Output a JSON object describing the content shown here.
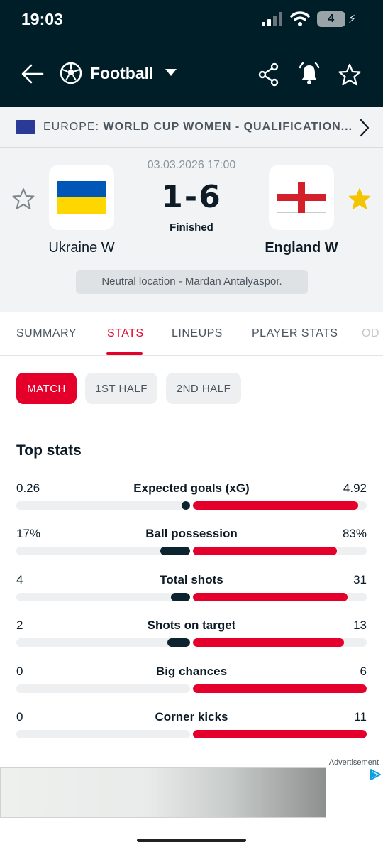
{
  "status_bar": {
    "time": "19:03",
    "battery": "4"
  },
  "nav": {
    "sport": "Football",
    "icons": [
      "back-arrow-icon",
      "football-icon",
      "chevron-down-icon",
      "share-icon",
      "bell-icon",
      "star-icon"
    ]
  },
  "league": {
    "region": "EUROPE:",
    "name": "WORLD CUP WOMEN - QUALIFICATION..."
  },
  "match": {
    "datetime": "03.03.2026 17:00",
    "score": "1-6",
    "status": "Finished",
    "home": {
      "name": "Ukraine W",
      "favorite": false,
      "flag_colors": [
        "#0057b7",
        "#ffd700"
      ]
    },
    "away": {
      "name": "England W",
      "favorite": true
    },
    "venue": "Neutral location - Mardan Antalyaspor."
  },
  "tabs": [
    "SUMMARY",
    "STATS",
    "LINEUPS",
    "PLAYER STATS",
    "OD"
  ],
  "active_tab": "STATS",
  "periods": [
    "MATCH",
    "1ST HALF",
    "2ND HALF"
  ],
  "active_period": "MATCH",
  "section_title": "Top stats",
  "stats": [
    {
      "name": "Expected goals (xG)",
      "home": "0.26",
      "away": "4.92",
      "home_share": 0.05,
      "away_share": 0.95
    },
    {
      "name": "Ball possession",
      "home": "17%",
      "away": "83%",
      "home_share": 0.17,
      "away_share": 0.83
    },
    {
      "name": "Total shots",
      "home": "4",
      "away": "31",
      "home_share": 0.11,
      "away_share": 0.89
    },
    {
      "name": "Shots on target",
      "home": "2",
      "away": "13",
      "home_share": 0.13,
      "away_share": 0.87
    },
    {
      "name": "Big chances",
      "home": "0",
      "away": "6",
      "home_share": 0,
      "away_share": 1
    },
    {
      "name": "Corner kicks",
      "home": "0",
      "away": "11",
      "home_share": 0,
      "away_share": 1
    }
  ],
  "ad": {
    "label": "Advertisement"
  },
  "colors": {
    "header": "#001e28",
    "accent": "#e4002b",
    "home_bar": "#0d2430",
    "star": "#f5c400"
  }
}
